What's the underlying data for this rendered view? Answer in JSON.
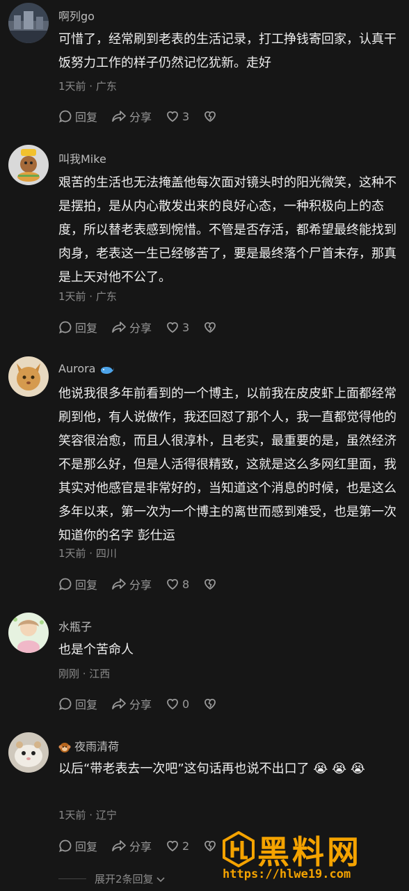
{
  "comments": [
    {
      "username": "啊列go",
      "text": "可惜了，经常刷到老表的生活记录，打工挣钱寄回家，认真干饭努力工作的样子仍然记忆犹新。走好",
      "meta": "1天前 · 广东",
      "reply_label": "回复",
      "share_label": "分享",
      "likes": "3"
    },
    {
      "username": "叫我Mike",
      "text": "艰苦的生活也无法掩盖他每次面对镜头时的阳光微笑，这种不是摆拍，是从内心散发出来的良好心态，一种积极向上的态度，所以替老表感到惋惜。不管是否存活，都希望最终能找到肉身，老表这一生已经够苦了，要是最终落个尸首未存，那真是上天对他不公了。",
      "meta": "1天前 · 广东",
      "reply_label": "回复",
      "share_label": "分享",
      "likes": "3"
    },
    {
      "username": "Aurora",
      "text": "他说我很多年前看到的一个博主，以前我在皮皮虾上面都经常刷到他，有人说做作，我还回怼了那个人，我一直都觉得他的笑容很治愈，而且人很淳朴，且老实，最重要的是，虽然经济不是那么好，但是人活得很精致，这就是这么多网红里面，我其实对他感官是非常好的，当知道这个消息的时候，也是这么多年以来，第一次为一个博主的离世而感到难受，也是第一次知道你的名字 彭仕运",
      "meta": "1天前 · 四川",
      "reply_label": "回复",
      "share_label": "分享",
      "likes": "8"
    },
    {
      "username": "水瓶子",
      "text": "也是个苦命人",
      "meta": "刚刚 · 江西",
      "reply_label": "回复",
      "share_label": "分享",
      "likes": "0"
    },
    {
      "username": "夜雨清荷",
      "text": "以后“带老表去一次吧”这句话再也说不出口了 😭 😭 😭",
      "meta": "1天前 · 辽宁",
      "reply_label": "回复",
      "share_label": "分享",
      "likes": "2"
    }
  ],
  "expand_replies": "展开2条回复",
  "watermark": {
    "title": "黑料网",
    "url": "https://hlwe19.com"
  },
  "colors": {
    "background": "#161616",
    "text": "#eeeeee",
    "muted": "#8a8a8a",
    "watermark": "#f5a300"
  }
}
